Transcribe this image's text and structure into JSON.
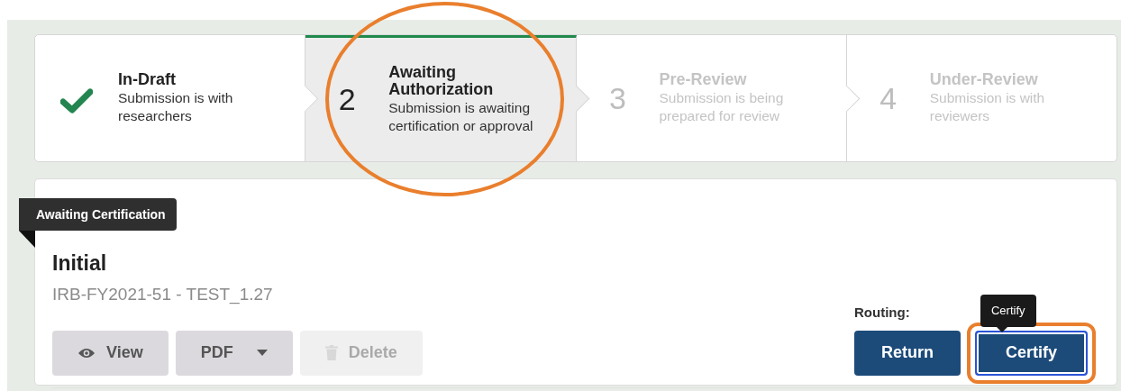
{
  "steps": [
    {
      "completed": true,
      "selected": false,
      "title": "In-Draft",
      "description": "Submission is with researchers",
      "highlighted": false
    },
    {
      "completed": false,
      "selected": true,
      "number": "2",
      "title": "Awaiting Authorization",
      "description": "Submission is awaiting certification or approval",
      "highlighted": true
    },
    {
      "completed": false,
      "selected": false,
      "number": "3",
      "title": "Pre-Review",
      "description": "Submission is being prepared for review",
      "highlighted": false
    },
    {
      "completed": false,
      "selected": false,
      "number": "4",
      "title": "Under-Review",
      "description": "Submission is with reviewers",
      "highlighted": false
    }
  ],
  "submission": {
    "ribbon": "Awaiting Certification",
    "title": "Initial",
    "subtitle": "IRB-FY2021-51 - TEST_1.27",
    "actions": [
      {
        "kind": "view",
        "label": "View",
        "disabled": false
      },
      {
        "kind": "dropdown",
        "label": "PDF",
        "disabled": false
      },
      {
        "kind": "delete",
        "label": "Delete",
        "disabled": true
      }
    ],
    "routing": {
      "label": "Routing:",
      "buttons": [
        {
          "label": "Return",
          "focused": false,
          "highlighted": false
        },
        {
          "label": "Certify",
          "focused": true,
          "highlighted": true,
          "tooltip": "Certify"
        }
      ]
    }
  }
}
